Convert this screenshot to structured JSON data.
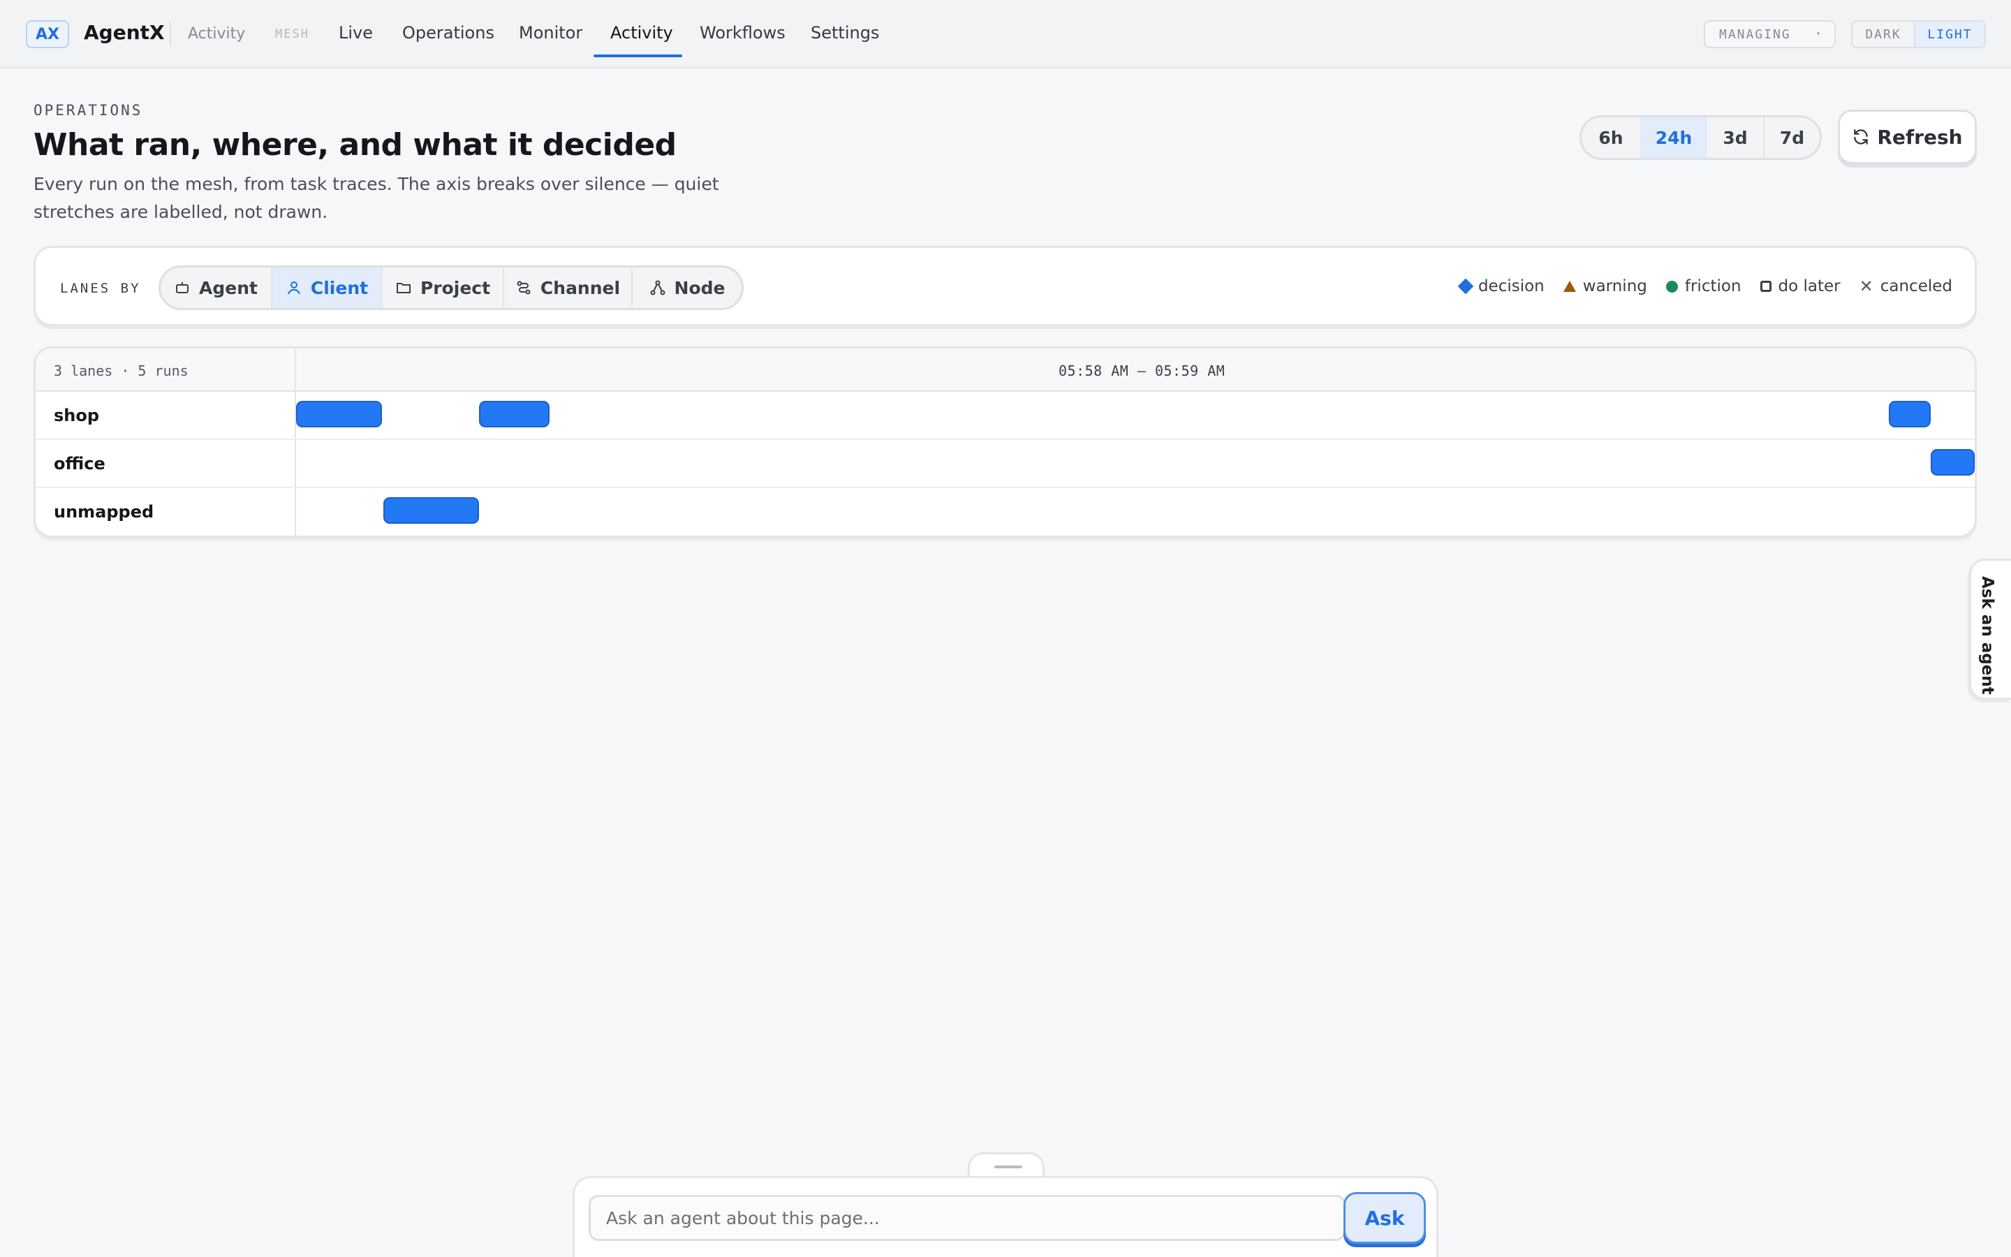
{
  "app": {
    "logo": "AX",
    "name": "AgentX",
    "crumb": "Activity",
    "mesh_label": "MESH"
  },
  "nav": {
    "items": [
      {
        "label": "Live"
      },
      {
        "label": "Operations"
      },
      {
        "label": "Monitor"
      },
      {
        "label": "Activity",
        "active": true
      },
      {
        "label": "Workflows"
      },
      {
        "label": "Settings"
      }
    ]
  },
  "controls": {
    "managing": "MANAGING",
    "theme_dark": "DARK",
    "theme_light": "LIGHT",
    "theme_selected": "LIGHT"
  },
  "header": {
    "kicker": "OPERATIONS",
    "title": "What ran, where, and what it decided",
    "subtitle": "Every run on the mesh, from task traces. The axis breaks over silence — quiet stretches are labelled, not drawn."
  },
  "range": {
    "options": [
      "6h",
      "24h",
      "3d",
      "7d"
    ],
    "selected": "24h"
  },
  "refresh_label": "Refresh",
  "lanes_by": {
    "label": "LANES BY",
    "options": [
      {
        "label": "Agent",
        "icon": "robot-icon"
      },
      {
        "label": "Client",
        "icon": "person-icon"
      },
      {
        "label": "Project",
        "icon": "folder-icon"
      },
      {
        "label": "Channel",
        "icon": "route-icon"
      },
      {
        "label": "Node",
        "icon": "network-icon"
      }
    ],
    "selected": "Client"
  },
  "legend": [
    {
      "label": "decision",
      "marker": "diamond",
      "color": "#1f6fe0"
    },
    {
      "label": "warning",
      "marker": "triangle",
      "color": "#9a5a00"
    },
    {
      "label": "friction",
      "marker": "dot",
      "color": "#1a8a5a"
    },
    {
      "label": "do later",
      "marker": "square",
      "color": "#3b4048"
    },
    {
      "label": "canceled",
      "marker": "x",
      "color": "#555b63"
    }
  ],
  "timeline": {
    "summary": "3 lanes · 5 runs",
    "range_label": "05:58 AM – 05:59 AM",
    "run_color": "#2378f5",
    "lanes": [
      {
        "name": "shop",
        "runs": [
          {
            "start": 0.0,
            "end": 0.051
          },
          {
            "start": 0.109,
            "end": 0.151
          },
          {
            "start": 0.949,
            "end": 0.974
          }
        ]
      },
      {
        "name": "office",
        "runs": [
          {
            "start": 0.974,
            "end": 1.0
          }
        ]
      },
      {
        "name": "unmapped",
        "runs": [
          {
            "start": 0.052,
            "end": 0.109
          }
        ]
      }
    ]
  },
  "side_tab": "Ask an agent",
  "ask": {
    "placeholder": "Ask an agent about this page...",
    "value": "",
    "button": "Ask"
  }
}
